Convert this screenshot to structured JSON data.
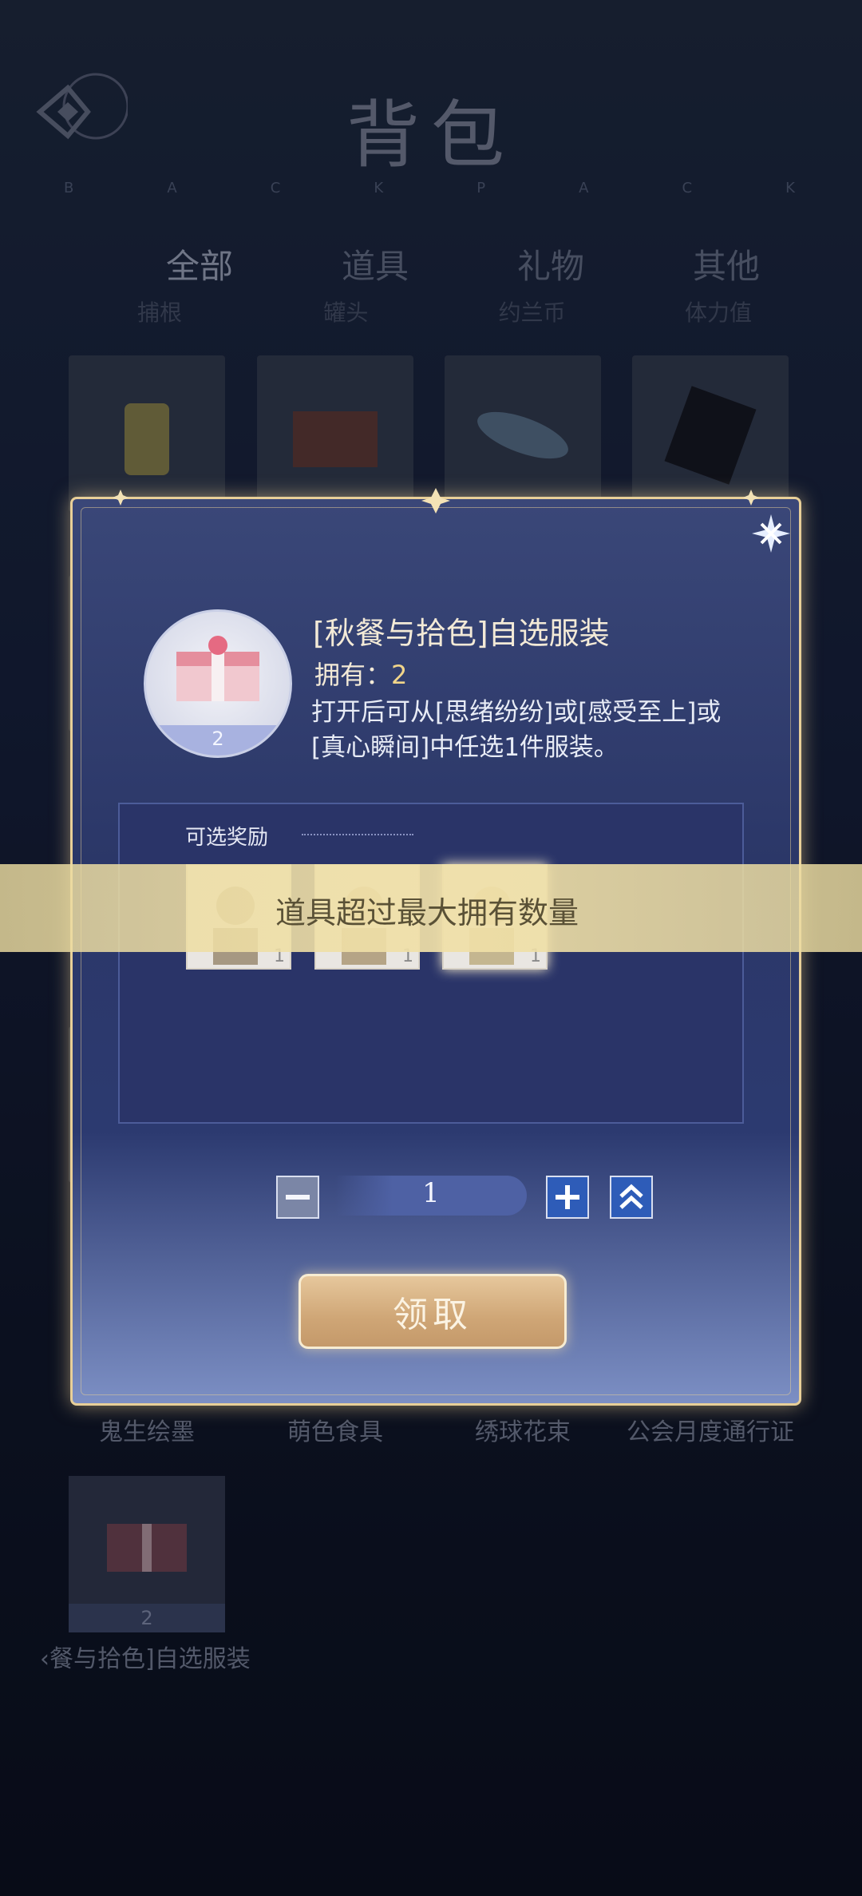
{
  "header": {
    "title": "背包",
    "subtitle_letters": [
      "B",
      "A",
      "C",
      "K",
      "P",
      "A",
      "C",
      "K"
    ]
  },
  "tabs": [
    {
      "label": "全部"
    },
    {
      "label": "道具"
    },
    {
      "label": "礼物"
    },
    {
      "label": "其他"
    }
  ],
  "subtabs": [
    "捕根",
    "罐头",
    "约兰币",
    "体力值"
  ],
  "background_labels": [
    "鬼生绘墨",
    "萌色食具",
    "绣球花束",
    "公会月度通行证"
  ],
  "background_item": {
    "count": "2",
    "label": "‹餐与拾色]自选服装"
  },
  "modal": {
    "item_count": "2",
    "item_title": "[秋餐与拾色]自选服装",
    "owned_label": "拥有：",
    "owned_value": "2",
    "description": "打开后可从[思绪纷纷]或[感受至上]或[真心瞬间]中任选1件服装。",
    "reward_section_label": "可选奖励",
    "rewards": [
      {
        "count": "1"
      },
      {
        "count": "1"
      },
      {
        "count": "1"
      }
    ],
    "quantity": "1",
    "claim_label": "领取"
  },
  "toast": {
    "message": "道具超过最大拥有数量"
  },
  "colors": {
    "accent_gold": "#e8cf98",
    "modal_blue": "#2b3768",
    "claim_button": "#cfa676"
  }
}
